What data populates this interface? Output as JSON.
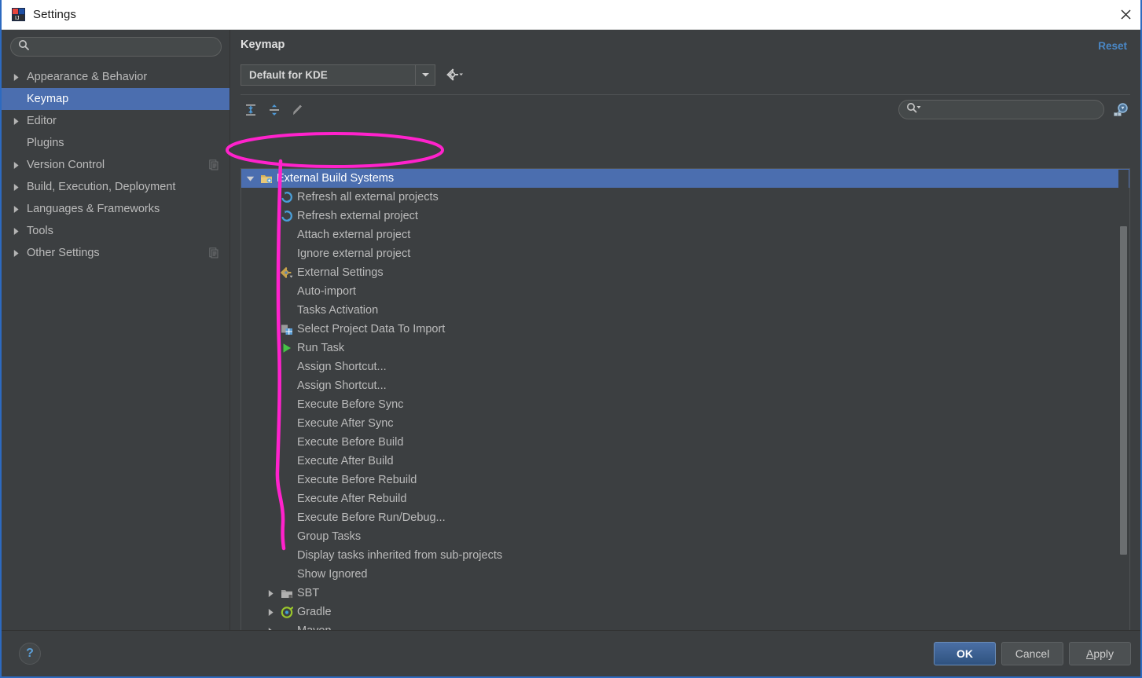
{
  "window": {
    "title": "Settings",
    "app_icon": "intellij-idea-icon",
    "close_icon": "close-icon",
    "accent_border": "#2d6ac0"
  },
  "sidebar": {
    "search": {
      "value": "",
      "placeholder": "",
      "icon": "search-icon"
    },
    "items": [
      {
        "label": "Appearance & Behavior",
        "expandable": true,
        "selected": false,
        "badge": false
      },
      {
        "label": "Keymap",
        "expandable": false,
        "selected": true,
        "badge": false
      },
      {
        "label": "Editor",
        "expandable": true,
        "selected": false,
        "badge": false
      },
      {
        "label": "Plugins",
        "expandable": false,
        "selected": false,
        "badge": false
      },
      {
        "label": "Version Control",
        "expandable": true,
        "selected": false,
        "badge": true
      },
      {
        "label": "Build, Execution, Deployment",
        "expandable": true,
        "selected": false,
        "badge": false
      },
      {
        "label": "Languages & Frameworks",
        "expandable": true,
        "selected": false,
        "badge": false
      },
      {
        "label": "Tools",
        "expandable": true,
        "selected": false,
        "badge": false
      },
      {
        "label": "Other Settings",
        "expandable": true,
        "selected": false,
        "badge": true
      }
    ],
    "selected_color": "#4b6eaf"
  },
  "main": {
    "title": "Keymap",
    "reset_label": "Reset",
    "reset_color": "#4a88c7",
    "keymap_select": {
      "value": "Default for KDE",
      "dropdown_icon": "chevron-down-icon"
    },
    "gear_label": "gear-icon",
    "toolbar": [
      {
        "name": "expand-all-icon"
      },
      {
        "name": "collapse-all-icon"
      },
      {
        "name": "edit-shortcut-icon"
      }
    ],
    "filter": {
      "value": "",
      "placeholder": "",
      "icon": "search-dropdown-icon"
    },
    "find_by_shortcut_icon": "find-by-shortcut-icon"
  },
  "tree": {
    "rows": [
      {
        "label": "External Build Systems",
        "indent": 0,
        "twisty": "down",
        "icon": "folder-icon",
        "selected": true
      },
      {
        "label": "Refresh all external projects",
        "indent": 1,
        "twisty": "none",
        "icon": "refresh-icon",
        "selected": false
      },
      {
        "label": "Refresh external project",
        "indent": 1,
        "twisty": "none",
        "icon": "refresh-icon",
        "selected": false
      },
      {
        "label": "Attach external project",
        "indent": 1,
        "twisty": "none",
        "icon": "none",
        "selected": false
      },
      {
        "label": "Ignore external project",
        "indent": 1,
        "twisty": "none",
        "icon": "none",
        "selected": false
      },
      {
        "label": "External Settings",
        "indent": 1,
        "twisty": "none",
        "icon": "settings-icon",
        "selected": false
      },
      {
        "label": "Auto-import",
        "indent": 1,
        "twisty": "none",
        "icon": "none",
        "selected": false
      },
      {
        "label": "Tasks Activation",
        "indent": 1,
        "twisty": "none",
        "icon": "none",
        "selected": false
      },
      {
        "label": "Select Project Data To Import",
        "indent": 1,
        "twisty": "none",
        "icon": "project-data-icon",
        "selected": false
      },
      {
        "label": "Run Task",
        "indent": 1,
        "twisty": "none",
        "icon": "run-icon",
        "selected": false
      },
      {
        "label": "Assign Shortcut...",
        "indent": 1,
        "twisty": "none",
        "icon": "none",
        "selected": false
      },
      {
        "label": "Assign Shortcut...",
        "indent": 1,
        "twisty": "none",
        "icon": "none",
        "selected": false
      },
      {
        "label": "Execute Before Sync",
        "indent": 1,
        "twisty": "none",
        "icon": "none",
        "selected": false
      },
      {
        "label": "Execute After Sync",
        "indent": 1,
        "twisty": "none",
        "icon": "none",
        "selected": false
      },
      {
        "label": "Execute Before Build",
        "indent": 1,
        "twisty": "none",
        "icon": "none",
        "selected": false
      },
      {
        "label": "Execute After Build",
        "indent": 1,
        "twisty": "none",
        "icon": "none",
        "selected": false
      },
      {
        "label": "Execute Before Rebuild",
        "indent": 1,
        "twisty": "none",
        "icon": "none",
        "selected": false
      },
      {
        "label": "Execute After Rebuild",
        "indent": 1,
        "twisty": "none",
        "icon": "none",
        "selected": false
      },
      {
        "label": "Execute Before Run/Debug...",
        "indent": 1,
        "twisty": "none",
        "icon": "none",
        "selected": false
      },
      {
        "label": "Group Tasks",
        "indent": 1,
        "twisty": "none",
        "icon": "none",
        "selected": false
      },
      {
        "label": "Display tasks inherited from sub-projects",
        "indent": 1,
        "twisty": "none",
        "icon": "none",
        "selected": false
      },
      {
        "label": "Show Ignored",
        "indent": 1,
        "twisty": "none",
        "icon": "none",
        "selected": false
      },
      {
        "label": "SBT",
        "indent": 1,
        "twisty": "right",
        "icon": "folder-gray-icon",
        "selected": false
      },
      {
        "label": "Gradle",
        "indent": 1,
        "twisty": "right",
        "icon": "gradle-icon",
        "selected": false
      },
      {
        "label": "Maven",
        "indent": 1,
        "twisty": "right",
        "icon": "maven-icon",
        "selected": false
      }
    ]
  },
  "footer": {
    "help_label": "?",
    "buttons": [
      {
        "label": "OK",
        "primary": true
      },
      {
        "label": "Cancel",
        "primary": false
      },
      {
        "label": "Apply",
        "primary": false,
        "mnemonic": "A"
      }
    ]
  },
  "annotation": {
    "color": "#ff22cc",
    "shapes": [
      "ellipse-around-external-build-systems",
      "vertical-bracket-line"
    ]
  }
}
